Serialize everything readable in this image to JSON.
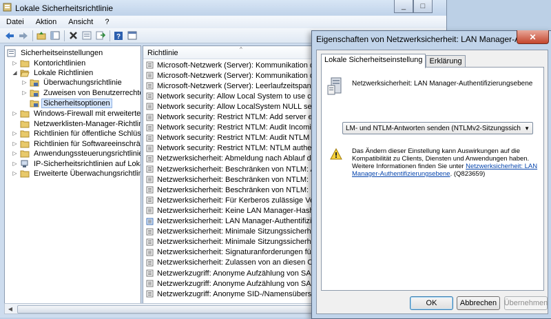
{
  "window": {
    "title": "Lokale Sicherheitsrichtlinie"
  },
  "menu": [
    "Datei",
    "Aktion",
    "Ansicht",
    "?"
  ],
  "toolbar": [
    "back-icon",
    "forward-icon",
    "up-icon",
    "show-hide-tree-icon",
    "delete-icon",
    "properties-icon",
    "export-icon",
    "help-icon",
    "console-icon"
  ],
  "tree": [
    {
      "label": "Sicherheitseinstellungen",
      "level": 0,
      "expander": "",
      "icon": "settings-icon"
    },
    {
      "label": "Kontorichtlinien",
      "level": 1,
      "expander": "▷",
      "icon": "folder-icon"
    },
    {
      "label": "Lokale Richtlinien",
      "level": 1,
      "expander": "◢",
      "icon": "folder-icon"
    },
    {
      "label": "Überwachungsrichtlinie",
      "level": 2,
      "expander": "▷",
      "icon": "folder-lock-icon"
    },
    {
      "label": "Zuweisen von Benutzerrechten",
      "level": 2,
      "expander": "▷",
      "icon": "folder-lock-icon"
    },
    {
      "label": "Sicherheitsoptionen",
      "level": 2,
      "expander": "",
      "icon": "folder-lock-icon",
      "selected": true
    },
    {
      "label": "Windows-Firewall mit erweiterter Sich",
      "level": 1,
      "expander": "▷",
      "icon": "folder-icon"
    },
    {
      "label": "Netzwerklisten-Manager-Richtlinien",
      "level": 1,
      "expander": "",
      "icon": "folder-icon"
    },
    {
      "label": "Richtlinien für öffentliche Schlüssel",
      "level": 1,
      "expander": "▷",
      "icon": "folder-icon"
    },
    {
      "label": "Richtlinien für Softwareeinschränkung",
      "level": 1,
      "expander": "▷",
      "icon": "folder-icon"
    },
    {
      "label": "Anwendungssteuerungsrichtlinien",
      "level": 1,
      "expander": "▷",
      "icon": "folder-icon"
    },
    {
      "label": "IP-Sicherheitsrichtlinien auf Lokaler C",
      "level": 1,
      "expander": "▷",
      "icon": "ipsec-icon"
    },
    {
      "label": "Erweiterte Überwachungsrichtlinienko",
      "level": 1,
      "expander": "▷",
      "icon": "folder-icon"
    }
  ],
  "list": {
    "column": "Richtlinie",
    "rows": [
      "Microsoft-Netzwerk (Server): Kommunikation digital",
      "Microsoft-Netzwerk (Server): Kommunikation digital",
      "Microsoft-Netzwerk (Server): Leerlaufzeitspanne bis z",
      "Network security: Allow Local System to use comput",
      "Network security: Allow LocalSystem NULL session fa",
      "Network security: Restrict NTLM: Add server exceptio",
      "Network security: Restrict NTLM: Audit Incoming NT",
      "Network security: Restrict NTLM: Audit NTLM authen",
      "Network security: Restrict NTLM: NTLM authenticati",
      "Netzwerksicherheit: Abmeldung nach Ablauf der Ann",
      "Netzwerksicherheit: Beschränken von NTLM: Ausgeh",
      "Netzwerksicherheit: Beschränken von NTLM: Eingehe",
      "Netzwerksicherheit: Beschränken von NTLM: Remote",
      "Netzwerksicherheit: Für Kerberos zulässige Verschlüs",
      "Netzwerksicherheit: Keine LAN Manager-Hashwerte f",
      "Netzwerksicherheit: LAN Manager-Authentifizierungs",
      "Netzwerksicherheit: Minimale Sitzungssicherheit für",
      "Netzwerksicherheit: Minimale Sitzungssicherheit für",
      "Netzwerksicherheit: Signaturanforderungen für LDAP",
      "Netzwerksicherheit: Zulassen von an diesen Compute",
      "Netzwerkzugriff: Anonyme Aufzählung von SAM-Kor",
      "Netzwerkzugriff: Anonyme Aufzählung von SAM-Kor",
      "Netzwerkzugriff: Anonyme SID-/Namensübersetzung"
    ],
    "selected_index": 15
  },
  "dialog": {
    "title": "Eigenschaften von Netzwerksicherheit: LAN Manager-Authent...",
    "tabs": [
      "Lokale Sicherheitseinstellung",
      "Erklärung"
    ],
    "policy_name": "Netzwerksicherheit: LAN Manager-Authentifizierungsebene",
    "combo_value": "LM- und NTLM-Antworten senden (NTLMv2-Sitzungssicherheit ver",
    "warning_text": "Das Ändern dieser Einstellung kann Auswirkungen auf die Kompatibilität zu Clients, Diensten und Anwendungen haben. Weitere Informationen finden Sie unter ",
    "warning_link": "Netzwerksicherheit: LAN Manager-Authentifizierungsebene",
    "warning_suffix": ". (Q823659)",
    "ok": "OK",
    "cancel": "Abbrechen",
    "apply": "Übernehmen"
  }
}
